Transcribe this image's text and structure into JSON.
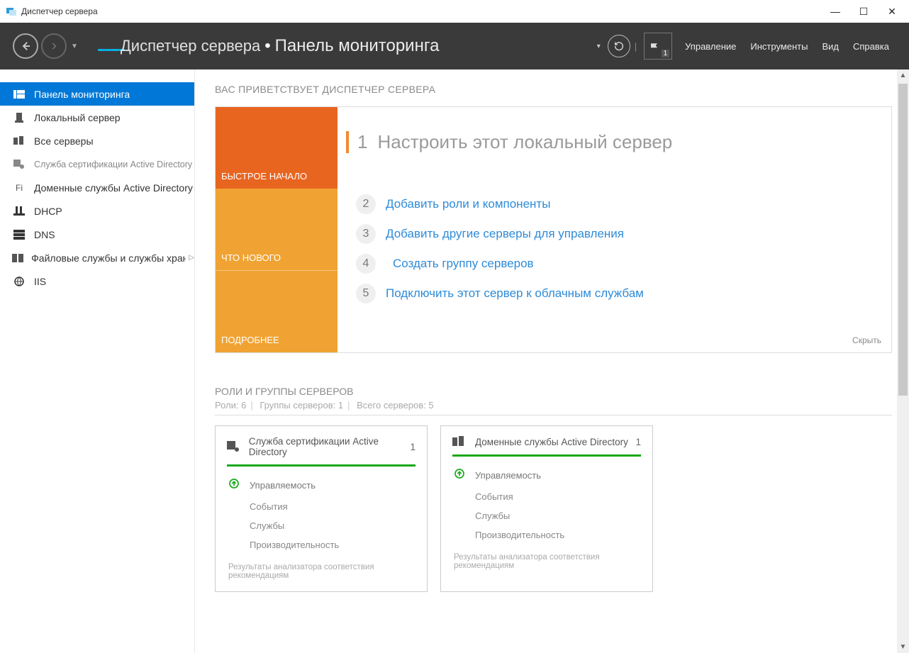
{
  "titlebar": {
    "app_title": "Диспетчер сервера"
  },
  "toolbar": {
    "breadcrumb_root": "Диспетчер сервера",
    "breadcrumb_page": "Панель мониторинга",
    "menu": {
      "manage": "Управление",
      "tools": "Инструменты",
      "view": "Вид",
      "help": "Справка"
    },
    "flag_badge": "1"
  },
  "sidebar": {
    "items": [
      {
        "label": "Панель мониторинга"
      },
      {
        "label": "Локальный сервер"
      },
      {
        "label": "Все серверы"
      },
      {
        "label": "Служба сертификации Active Directory"
      },
      {
        "label": "Доменные службы Active Directory",
        "prefix": "Fi"
      },
      {
        "label": "DHCP"
      },
      {
        "label": "DNS"
      },
      {
        "label": "Файловые службы и службы хранилища",
        "suffix": "▷"
      },
      {
        "label": "IIS"
      }
    ]
  },
  "welcome": {
    "heading": "ВАС ПРИВЕТСТВУЕТ ДИСПЕТЧЕР СЕРВЕРА",
    "tiles": {
      "quick_start": "БЫСТРОЕ НАЧАЛО",
      "whats_new": "ЧТО НОВОГО",
      "learn_more": "ПОДРОБНЕЕ"
    },
    "steps": {
      "s1_num": "1",
      "s1": "Настроить этот локальный сервер",
      "s2_num": "2",
      "s2": "Добавить роли и компоненты",
      "s3_num": "3",
      "s3": "Добавить другие серверы для управления",
      "s4_num": "4",
      "s4": "Создать группу серверов",
      "s5_num": "5",
      "s5": "Подключить этот сервер к облачным службам"
    },
    "hide": "Скрыть"
  },
  "roles": {
    "title": "РОЛИ И ГРУППЫ СЕРВЕРОВ",
    "sub_roles_label": "Роли:",
    "sub_roles_count": "6",
    "sub_groups_label": "Группы серверов:",
    "sub_groups_count": "1",
    "sub_total_label": "Всего серверов:",
    "sub_total_count": "5",
    "card_rows": {
      "manageability": "Управляемость",
      "events": "События",
      "services": "Службы",
      "performance": "Производительность",
      "bpa": "Результаты анализатора соответствия рекомендациям"
    },
    "cards": [
      {
        "title": "Служба сертификации Active Directory",
        "count": "1"
      },
      {
        "title": "Доменные службы Active Directory",
        "count": "1"
      }
    ]
  }
}
